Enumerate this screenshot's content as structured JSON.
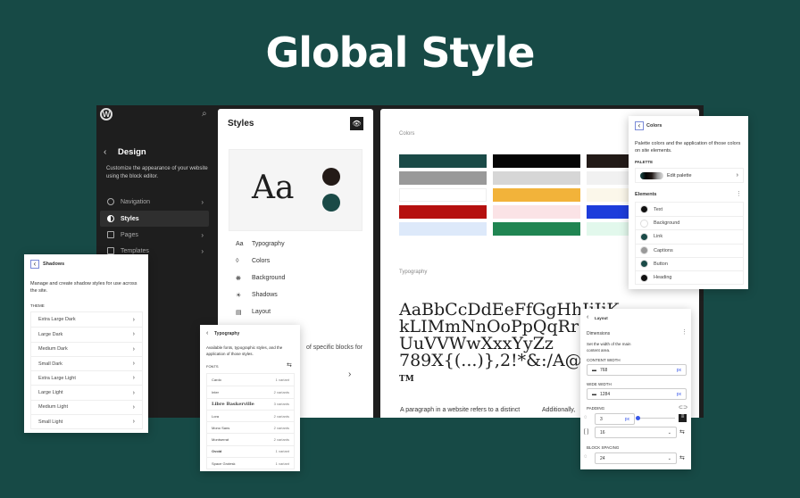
{
  "title": "Global Style",
  "sidebar": {
    "heading": "Design",
    "description": "Customize the appearance of your website using the block editor.",
    "items": [
      {
        "label": "Navigation"
      },
      {
        "label": "Styles"
      },
      {
        "label": "Pages"
      },
      {
        "label": "Templates"
      }
    ]
  },
  "styles": {
    "title": "Styles",
    "preview_text": "Aa",
    "menu": [
      {
        "label": "Typography",
        "icon": "Aa"
      },
      {
        "label": "Colors",
        "icon": "◊"
      },
      {
        "label": "Background",
        "icon": "❋"
      },
      {
        "label": "Shadows",
        "icon": "☀"
      },
      {
        "label": "Layout",
        "icon": "▤"
      }
    ],
    "blocks_fragment": "of specific blocks for"
  },
  "canvas": {
    "colors_label": "Colors",
    "typography_label": "Typography",
    "swatches": [
      [
        "#1a4a47",
        "#050505",
        "#221a17"
      ],
      [
        "#999999",
        "#d6d6d6",
        "#f1f1f1"
      ],
      [
        "#ffffff",
        "#f2b33a",
        "#fbf7ea"
      ],
      [
        "#b5100f",
        "#fbe3e6",
        "#1d3ddb"
      ],
      [
        "#dde9fa",
        "#208552",
        "#e2f8ec"
      ]
    ],
    "specimen": [
      "AaBbCcDdEeFfGgHhIiJjK",
      "kLIMmNnOoPpQqRr",
      "UuVVWwXxxYyZz",
      "789X{(...)},2!*&:/A@",
      "TM"
    ],
    "paragraph": "A paragraph in a website refers to a distinct",
    "paragraph2": "Additionally,"
  },
  "shadows": {
    "title": "Shadows",
    "description": "Manage and create shadow styles for use across the site.",
    "section": "THEME",
    "items": [
      "Extra Large Dark",
      "Large Dark",
      "Medium Dark",
      "Small Dark",
      "Extra Large Light",
      "Large Light",
      "Medium Light",
      "Small Light"
    ]
  },
  "typography": {
    "title": "Typography",
    "description": "Available fonts, typographic styles, and the application of those styles.",
    "section": "FONTS",
    "fonts": [
      {
        "name": "Cardo",
        "variants": "1 variant"
      },
      {
        "name": "Inter",
        "variants": "2 variants"
      },
      {
        "name": "Libre Baskerville",
        "variants": "3 variants"
      },
      {
        "name": "Lora",
        "variants": "2 variants"
      },
      {
        "name": "Mono Sans",
        "variants": "2 variants"
      },
      {
        "name": "Montserrat",
        "variants": "2 variants"
      },
      {
        "name": "Ovoid",
        "variants": "1 variant"
      },
      {
        "name": "Space Grotesk",
        "variants": "1 variant"
      }
    ]
  },
  "colors_panel": {
    "title": "Colors",
    "description": "Palette colors and the application of those colors on site elements.",
    "palette_label": "PALETTE",
    "edit_palette": "Edit palette",
    "elements_label": "Elements",
    "elements": [
      {
        "name": "Text",
        "color": "#111111"
      },
      {
        "name": "Background",
        "color": "#ffffff"
      },
      {
        "name": "Link",
        "color": "#1a4a47"
      },
      {
        "name": "Captions",
        "color": "#999999"
      },
      {
        "name": "Button",
        "color": "#1a4a47"
      },
      {
        "name": "Heading",
        "color": "#111111"
      }
    ]
  },
  "layout": {
    "title": "Layout",
    "section": "Dimensions",
    "description": "Set the width of the main content area.",
    "content_width_label": "CONTENT WIDTH",
    "content_width": "768",
    "wide_width_label": "WIDE WIDTH",
    "wide_width": "1284",
    "unit": "px",
    "padding_label": "PADDING",
    "padding_value": "3",
    "padding_unit": "px",
    "padding_select": "16",
    "block_spacing_label": "BLOCK SPACING",
    "block_spacing": "24"
  }
}
